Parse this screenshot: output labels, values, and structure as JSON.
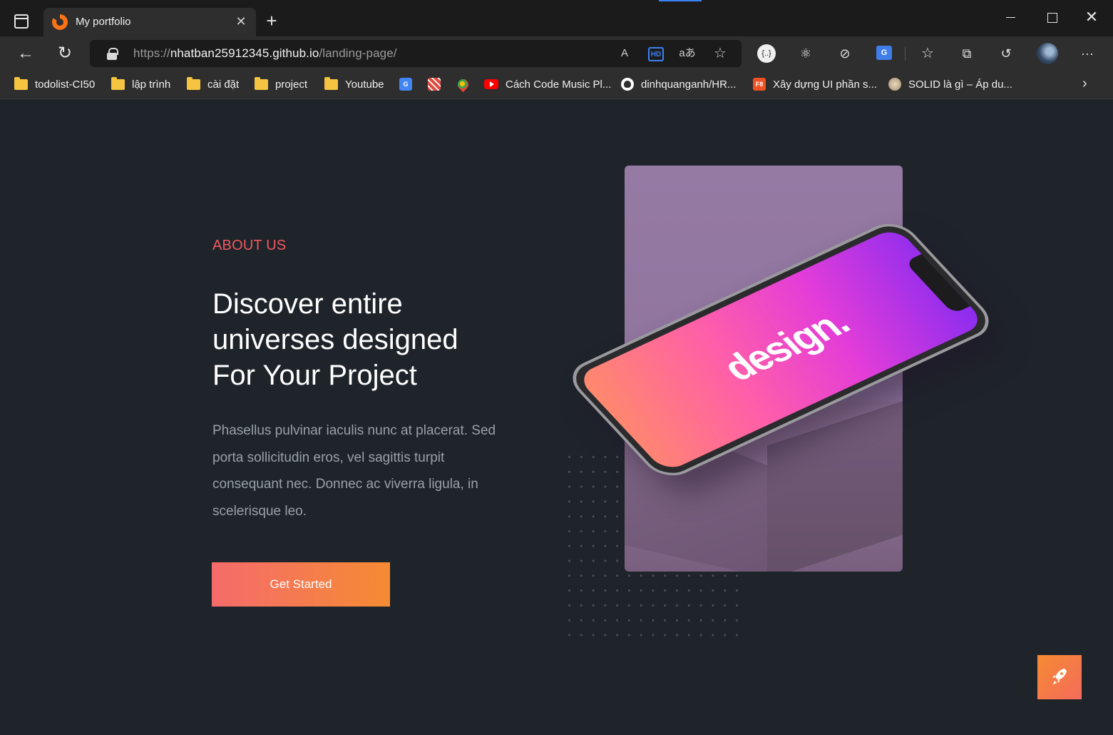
{
  "browser": {
    "tab": {
      "title": "My portfolio",
      "close": "✕"
    },
    "new_tab": "+",
    "window": {
      "minimize": "",
      "maximize": "",
      "close": "✕"
    },
    "nav": {
      "back": "←",
      "refresh": "↻"
    },
    "address": {
      "scheme": "https://",
      "host": "nhatban25912345.github.io",
      "path": "/landing-page/"
    },
    "address_icons": {
      "read_aloud": "A",
      "hd": "HD",
      "translate": "aあ",
      "add_favorite": "☆"
    },
    "toolbar_icons": {
      "ext1": "{..}",
      "ext2": "⚛",
      "ext3": "⊘",
      "ext4": "G",
      "favorites": "☆",
      "collections": "⧉",
      "history": "↺",
      "more": "···"
    },
    "bookmarks": [
      {
        "label": "todolist-CI50",
        "type": "folder"
      },
      {
        "label": "lập trình",
        "type": "folder"
      },
      {
        "label": "cài đặt",
        "type": "folder"
      },
      {
        "label": "project",
        "type": "folder"
      },
      {
        "label": "Youtube",
        "type": "folder"
      },
      {
        "label": "",
        "type": "google-translate"
      },
      {
        "label": "",
        "type": "plus"
      },
      {
        "label": "",
        "type": "maps"
      },
      {
        "label": "Cách Code Music Pl...",
        "type": "youtube"
      },
      {
        "label": "dinhquanganh/HR...",
        "type": "github"
      },
      {
        "label": "Xây dựng UI phần s...",
        "type": "f8"
      },
      {
        "label": "SOLID là gì – Áp du...",
        "type": "solid"
      }
    ],
    "bookmarks_more": "›",
    "colors": {
      "accent": "#3b82f6"
    }
  },
  "about": {
    "label": "ABOUT US",
    "headline_lines": [
      "Discover entire",
      "universes designed",
      "For Your Project"
    ],
    "body": "Phasellus pulvinar iaculis nunc at placerat. Sed porta sollicitudin eros, vel sagittis turpit consequant nec. Donnec ac viverra ligula, in scelerisque leo.",
    "cta": "Get Started",
    "phone_screen_text": "design."
  },
  "colors": {
    "label": "#f0595e",
    "cta_start": "#f56b6b",
    "cta_end": "#f58b33",
    "page_bg": "#1f242b"
  }
}
